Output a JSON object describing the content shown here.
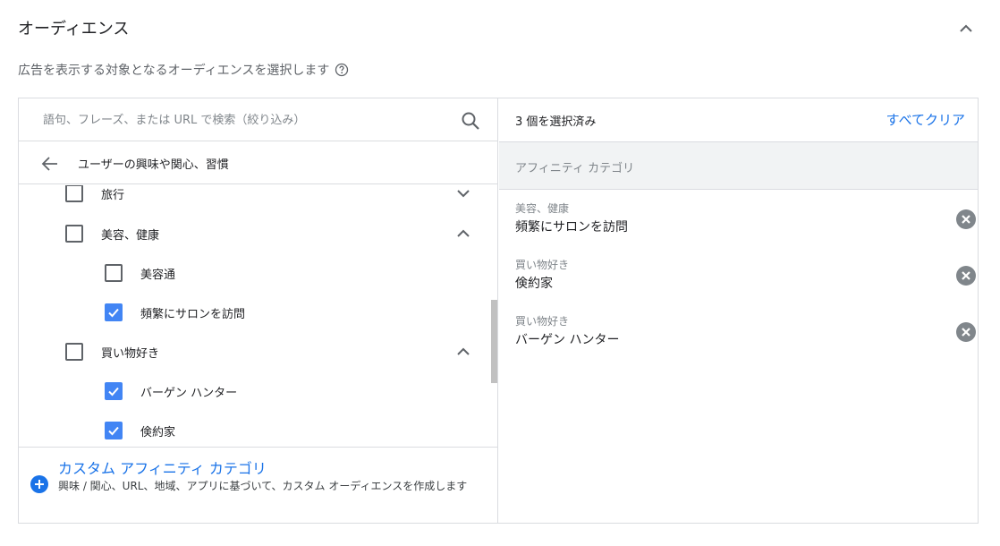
{
  "header": {
    "title": "オーディエンス",
    "subtitle": "広告を表示する対象となるオーディエンスを選択します"
  },
  "search": {
    "placeholder": "語句、フレーズ、または URL で検索（絞り込み）",
    "value": ""
  },
  "breadcrumb": "ユーザーの興味や関心、習慣",
  "tree": {
    "items": [
      {
        "label": "旅行",
        "checked": false,
        "level": 1,
        "expand": "chevron-down"
      },
      {
        "label": "美容、健康",
        "checked": false,
        "level": 1,
        "expand": "chevron-up"
      },
      {
        "label": "美容通",
        "checked": false,
        "level": 2
      },
      {
        "label": "頻繁にサロンを訪問",
        "checked": true,
        "level": 2
      },
      {
        "label": "買い物好き",
        "checked": false,
        "level": 1,
        "expand": "chevron-up"
      },
      {
        "label": "バーゲン ハンター",
        "checked": true,
        "level": 2
      },
      {
        "label": "倹約家",
        "checked": true,
        "level": 2
      }
    ]
  },
  "custom": {
    "title": "カスタム アフィニティ カテゴリ",
    "description": "興味 / 関心、URL、地域、アプリに基づいて、カスタム オーディエンスを作成します"
  },
  "selected": {
    "count_label": "3 個を選択済み",
    "clear_all": "すべてクリア",
    "category": "アフィニティ カテゴリ",
    "items": [
      {
        "parent": "美容、健康",
        "name": "頻繁にサロンを訪問"
      },
      {
        "parent": "買い物好き",
        "name": "倹約家"
      },
      {
        "parent": "買い物好き",
        "name": "バーゲン ハンター"
      }
    ]
  },
  "colors": {
    "accent": "#1a73e8",
    "checkbox_checked": "#4285f4",
    "border": "#dadce0"
  }
}
